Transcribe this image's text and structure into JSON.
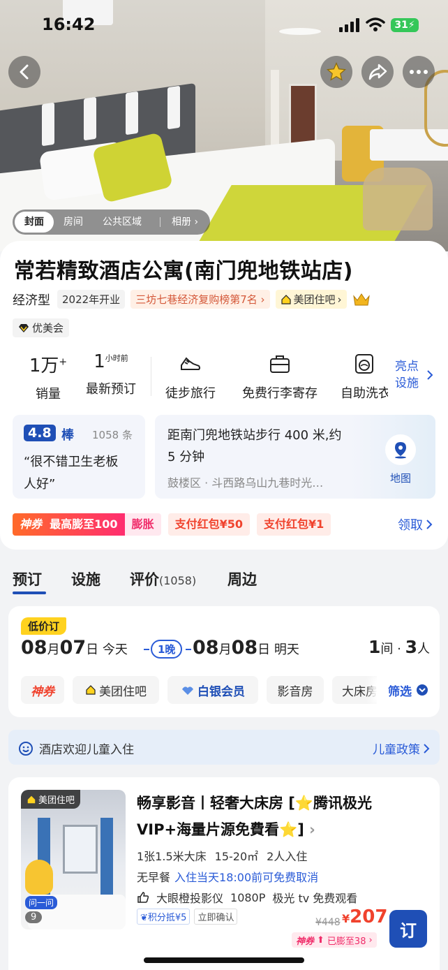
{
  "status_bar": {
    "time": "16:42",
    "battery": "31"
  },
  "hero": {
    "tabs": [
      "封面",
      "房间",
      "公共区域"
    ],
    "album": "相册"
  },
  "hotel": {
    "name": "常若精致酒店公寓(南门兜地铁站店)",
    "type": "经济型",
    "opened": "2022年开业",
    "ranking": "三坊七巷经济复购榜第7名",
    "mt_badge": "美团住吧",
    "vip": "优美会"
  },
  "stats": {
    "sales_value": "1万",
    "sales_sup": "+",
    "sales_label": "销量",
    "recent_value": "1",
    "recent_sup": "小时前",
    "recent_label": "最新预订",
    "facilities": [
      "徒步旅行",
      "免费行李寄存",
      "自助洗衣"
    ],
    "highlights": "亮点设施",
    "highlights_line1": "亮点",
    "highlights_line2": "设施"
  },
  "review": {
    "score": "4.8",
    "word": "棒",
    "count": "1058 条",
    "quote_line1": "“很不错卫生老板",
    "quote_line2": "人好”"
  },
  "location": {
    "line1": "距南门兜地铁站步行 400 米,约",
    "line2": "5 分钟",
    "address": "鼓楼区 · 斗西路乌山九巷时光…",
    "map_label": "地图"
  },
  "promo": {
    "shenquan": "神券",
    "boost": "最高膨至100",
    "boost_btn": "膨胀",
    "redpack1": "支付红包¥50",
    "redpack2": "支付红包¥1",
    "claim": "领取"
  },
  "tabs": [
    {
      "label": "预订"
    },
    {
      "label": "设施"
    },
    {
      "label": "评价",
      "count": "(1058)"
    },
    {
      "label": "周边"
    }
  ],
  "booking": {
    "low_price": "低价订",
    "checkin_month": "08",
    "checkin_day": "07",
    "checkin_rel": "今天",
    "nights": "1晚",
    "checkout_month": "08",
    "checkout_day": "08",
    "checkout_rel": "明天",
    "rooms": "1",
    "people": "3",
    "month_unit": "月",
    "day_unit": "日",
    "rooms_unit": "间 · ",
    "people_unit": "人",
    "filters": [
      "神券",
      "美团住吧",
      "白银会员",
      "影音房",
      "大床房"
    ],
    "filter_btn": "筛选"
  },
  "kids": {
    "text": "酒店欢迎儿童入住",
    "policy": "儿童政策"
  },
  "room": {
    "badge": "美团住吧",
    "ask": "问一问",
    "photo_count": "9",
    "title": "畅享影音丨轻奢大床房 [⭐腾讯极光VIP+海量片源免費看⭐]",
    "bed": "1张1.5米大床",
    "area": "15-20㎡",
    "guests": "2人入住",
    "breakfast": "无早餐",
    "cancel": "入住当天18:00前可免费取消",
    "feat1": "大眼橙投影仪",
    "feat2": "1080P",
    "feat3": "极光 tv 免费观看",
    "tag1": "积分抵¥5",
    "tag2": "立即确认",
    "old_price": "¥448",
    "currency": "¥",
    "price": "207",
    "book": "订",
    "boost_tag": "神券",
    "boost_text": "已膨至38"
  },
  "colors": {
    "brand_blue": "#1f4fb6",
    "link_blue": "#2a5bd7",
    "accent_red": "#f0422d",
    "accent_yellow": "#ffd21f"
  }
}
